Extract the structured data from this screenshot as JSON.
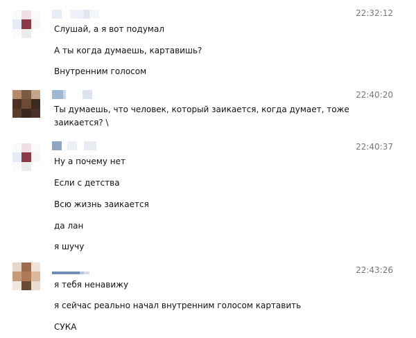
{
  "messages": [
    {
      "time": "22:32:12",
      "lines": [
        "Слушай, а я вот подумал",
        "А ты когда думаешь, картавишь?",
        "Внутренним голосом"
      ]
    },
    {
      "time": "22:40:20",
      "lines": [
        "Ты думаешь, что человек, который заикается, когда думает, тоже",
        "заикается? \\"
      ]
    },
    {
      "time": "22:40:37",
      "lines": [
        "Ну а почему нет",
        "Если с детства",
        "Всю жизнь заикается",
        "да лан",
        "я шучу"
      ]
    },
    {
      "time": "22:43:26",
      "lines": [
        "я тебя ненавижу",
        "я сейчас реально начал внутренним голосом картавить",
        "СУКА"
      ]
    }
  ],
  "colors": {
    "time": "#777777",
    "text": "#111111"
  }
}
